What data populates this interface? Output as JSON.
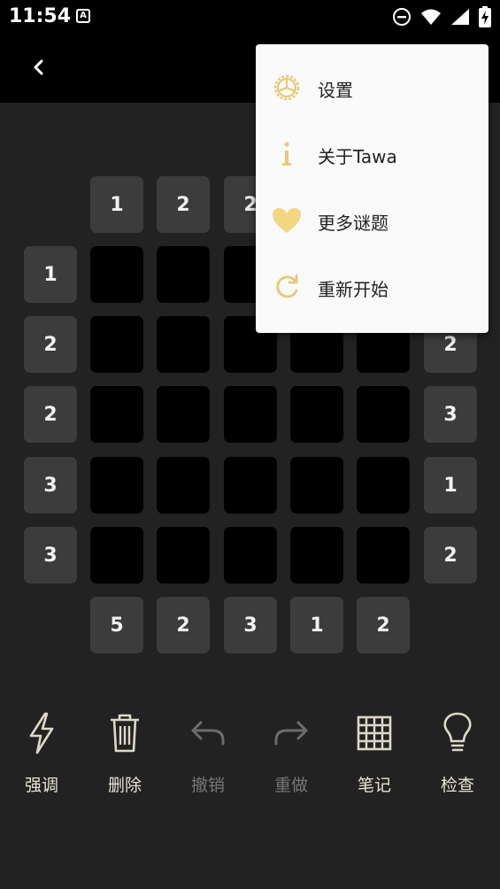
{
  "status_bar": {
    "time": "11:54",
    "app_badge": "A",
    "icons": [
      "dnd-icon",
      "wifi-icon",
      "signal-icon",
      "battery-charging-icon"
    ]
  },
  "app_bar": {
    "back_icon": "chevron-left-icon"
  },
  "colors": {
    "accent": "#e8c877",
    "background": "#222222",
    "clue_bg": "#3c3c3c",
    "cell_bg": "#000000",
    "menu_bg": "#fafafa"
  },
  "board": {
    "top_clues": [
      "1",
      "2",
      "2"
    ],
    "left_clues": [
      "1",
      "2",
      "2",
      "3",
      "3"
    ],
    "right_clues": [
      "2",
      "3",
      "1",
      "2"
    ],
    "bottom_clues": [
      "5",
      "2",
      "3",
      "1",
      "2"
    ]
  },
  "toolbar": [
    {
      "label": "强调",
      "icon": "lightning-icon",
      "enabled": true
    },
    {
      "label": "删除",
      "icon": "trash-icon",
      "enabled": true
    },
    {
      "label": "撤销",
      "icon": "undo-icon",
      "enabled": false
    },
    {
      "label": "重做",
      "icon": "redo-icon",
      "enabled": false
    },
    {
      "label": "笔记",
      "icon": "grid-icon",
      "enabled": true
    },
    {
      "label": "检查",
      "icon": "lightbulb-icon",
      "enabled": true
    }
  ],
  "menu": {
    "items": [
      {
        "label": "设置",
        "icon": "settings-icon"
      },
      {
        "label": "关于Tawa",
        "icon": "info-icon"
      },
      {
        "label": "更多谜题",
        "icon": "heart-icon"
      },
      {
        "label": "重新开始",
        "icon": "restart-icon"
      }
    ]
  }
}
